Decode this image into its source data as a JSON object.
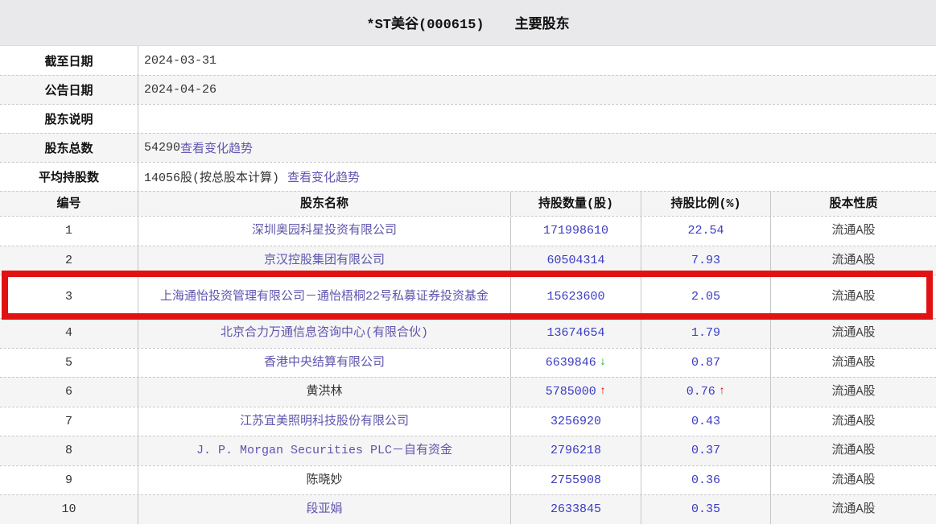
{
  "title": {
    "company": "*ST美谷(000615)",
    "section": "主要股东"
  },
  "info": [
    {
      "label": "截至日期",
      "value": "2024-03-31",
      "link": ""
    },
    {
      "label": "公告日期",
      "value": "2024-04-26",
      "link": ""
    },
    {
      "label": "股东说明",
      "value": "",
      "link": ""
    },
    {
      "label": "股东总数",
      "value": "54290",
      "link": "查看变化趋势"
    },
    {
      "label": "平均持股数",
      "value": "14056股(按总股本计算)",
      "link": "查看变化趋势"
    }
  ],
  "table": {
    "headers": {
      "no": "编号",
      "name": "股东名称",
      "shares": "持股数量(股)",
      "pct": "持股比例(%)",
      "type": "股本性质"
    },
    "rows": [
      {
        "no": "1",
        "name": "深圳奥园科星投资有限公司",
        "shares": "171998610",
        "shares_arrow": "",
        "pct": "22.54",
        "pct_arrow": "",
        "type": "流通A股",
        "highlighted": false
      },
      {
        "no": "2",
        "name": "京汉控股集团有限公司",
        "shares": "60504314",
        "shares_arrow": "",
        "pct": "7.93",
        "pct_arrow": "",
        "type": "流通A股",
        "highlighted": false
      },
      {
        "no": "3",
        "name": "上海通怡投资管理有限公司－通怡梧桐22号私募证券投资基金",
        "shares": "15623600",
        "shares_arrow": "",
        "pct": "2.05",
        "pct_arrow": "",
        "type": "流通A股",
        "highlighted": true
      },
      {
        "no": "4",
        "name": "北京合力万通信息咨询中心(有限合伙)",
        "shares": "13674654",
        "shares_arrow": "",
        "pct": "1.79",
        "pct_arrow": "",
        "type": "流通A股",
        "highlighted": false
      },
      {
        "no": "5",
        "name": "香港中央结算有限公司",
        "shares": "6639846",
        "shares_arrow": "↓",
        "pct": "0.87",
        "pct_arrow": "",
        "type": "流通A股",
        "highlighted": false
      },
      {
        "no": "6",
        "name": "黄洪林",
        "shares": "5785000",
        "shares_arrow": "↑",
        "pct": "0.76",
        "pct_arrow": "↑",
        "type": "流通A股",
        "highlighted": false
      },
      {
        "no": "7",
        "name": "江苏宜美照明科技股份有限公司",
        "shares": "3256920",
        "shares_arrow": "",
        "pct": "0.43",
        "pct_arrow": "",
        "type": "流通A股",
        "highlighted": false
      },
      {
        "no": "8",
        "name": "J. P. Morgan Securities PLC－自有资金",
        "shares": "2796218",
        "shares_arrow": "",
        "pct": "0.37",
        "pct_arrow": "",
        "type": "流通A股",
        "highlighted": false
      },
      {
        "no": "9",
        "name": "陈晓妙",
        "shares": "2755908",
        "shares_arrow": "",
        "pct": "0.36",
        "pct_arrow": "",
        "type": "流通A股",
        "highlighted": false
      },
      {
        "no": "10",
        "name": "段亚娟",
        "shares": "2633845",
        "shares_arrow": "",
        "pct": "0.35",
        "pct_arrow": "",
        "type": "流通A股",
        "highlighted": false
      }
    ]
  },
  "colors": {
    "titlebar_bg": "#e9e9eb",
    "stripe_bg": "#f5f5f6",
    "link_purple": "#6156b0",
    "name_link_purple": "#5e55ad",
    "value_blue": "#3b3bc4",
    "arrow_up_red": "#e60000",
    "arrow_down_green": "#0a9f20",
    "highlight_box_red": "#e21212"
  }
}
